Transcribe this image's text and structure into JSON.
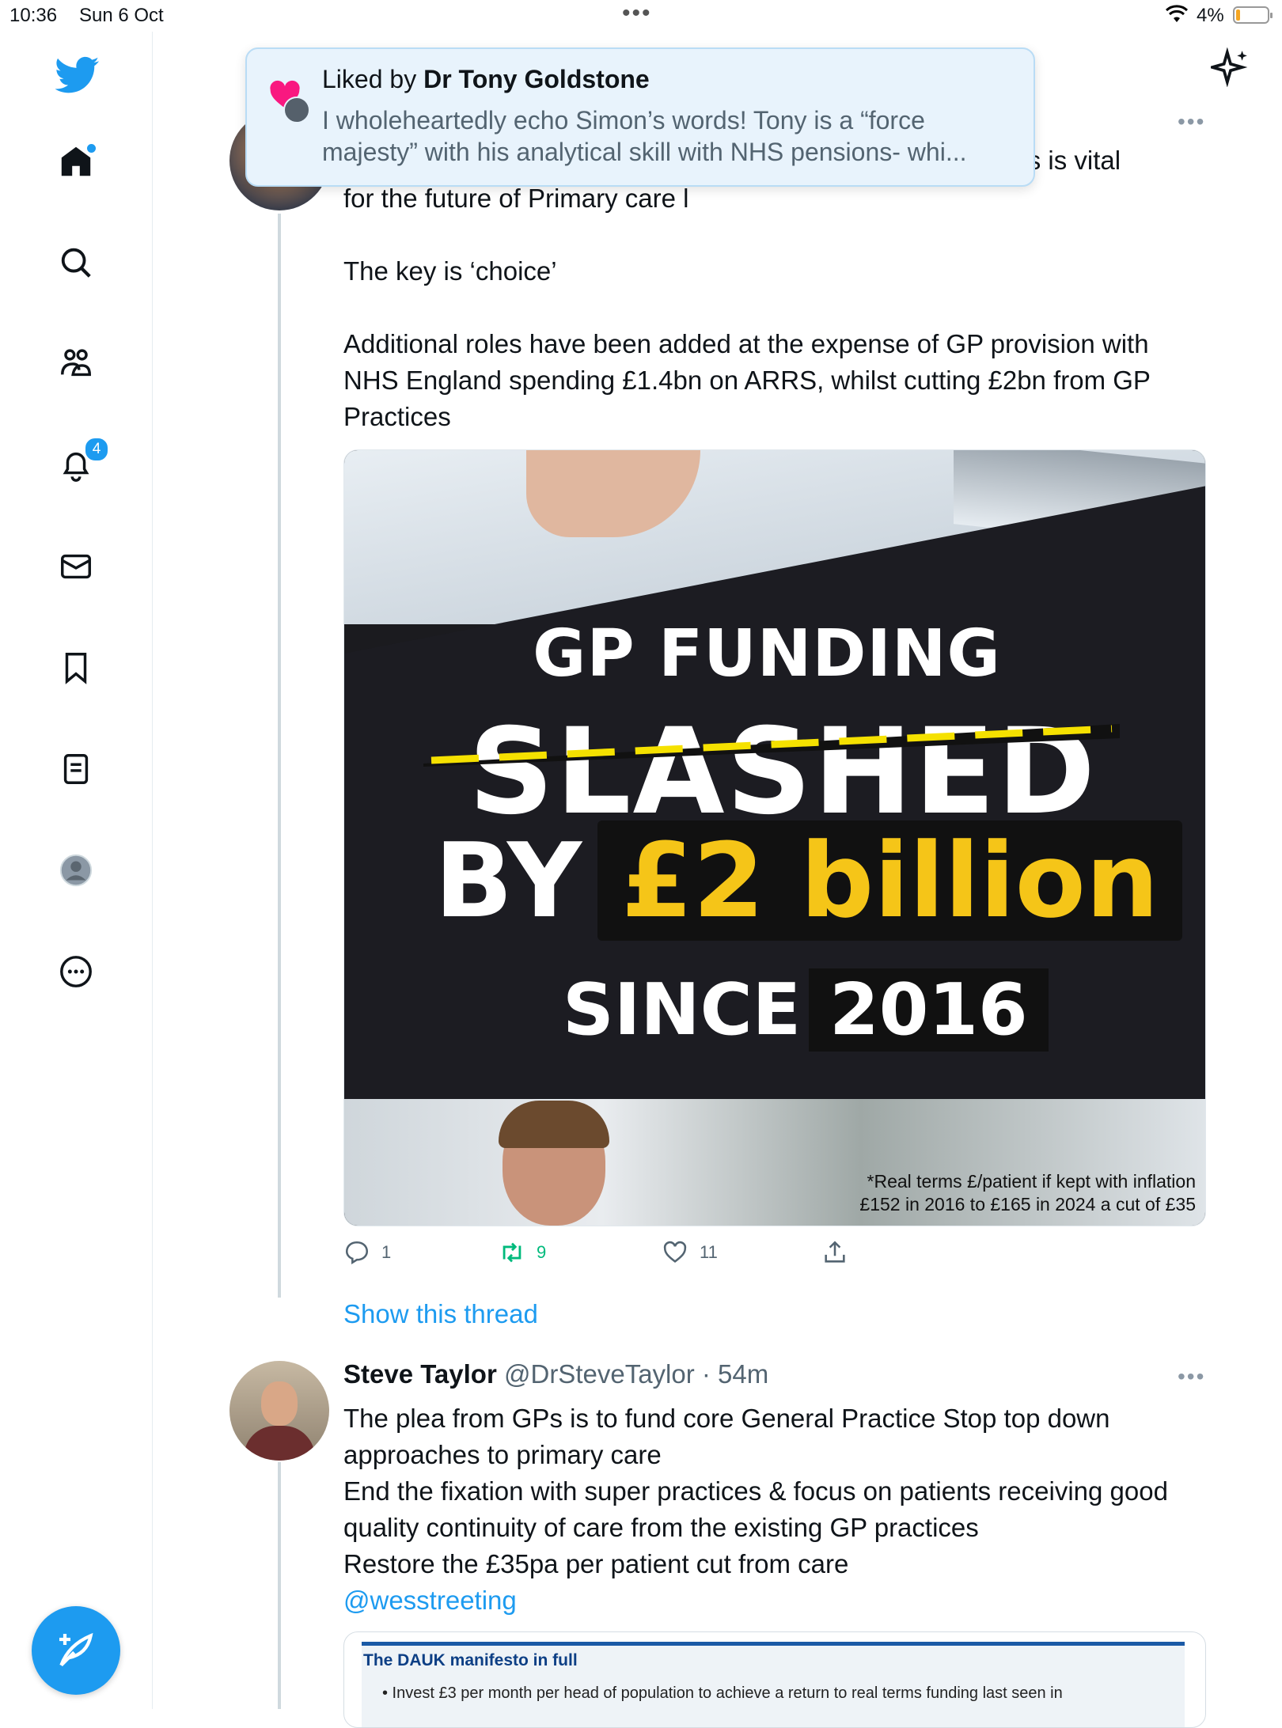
{
  "status_bar": {
    "time": "10:36",
    "date": "Sun 6 Oct",
    "battery": "4%"
  },
  "sidebar": {
    "notification_count": "4"
  },
  "notification_banner": {
    "prefix": "Liked by ",
    "user": "Dr Tony Goldstone",
    "line1": "I wholeheartedly echo Simon’s words! Tony is a “force",
    "line2": "majesty” with his analytical skill with NHS pensions- whi..."
  },
  "tweet1": {
    "partial_line": "atients is vital",
    "line_future": "for the future of Primary care l",
    "line_key": "The key is ‘choice’",
    "para3_line1": "Additional roles have been added at the expense of GP provision with",
    "para3_line2": "NHS England spending £1.4bn on ARRS, whilst cutting £2bn from GP",
    "para3_line3": "Practices",
    "image": {
      "headline1": "GP FUNDING",
      "headline2": "SLASHED",
      "headline3_by": "BY",
      "headline3_amount": "£2 billion",
      "headline4_since": "SINCE",
      "headline4_year": "2016",
      "footnote1": "*Real terms £/patient if kept with inflation",
      "footnote2": "£152 in 2016 to £165 in 2024 a cut of £35"
    },
    "replies": "1",
    "retweets": "9",
    "likes": "11"
  },
  "show_thread": "Show this thread",
  "tweet2": {
    "name": "Steve Taylor",
    "meta": "@DrSteveTaylor · 54m",
    "line1": "The plea from GPs is to fund core General Practice Stop top down",
    "line2": "approaches to primary care",
    "line3": "End the fixation with super practices & focus on patients receiving good",
    "line4": "quality continuity of care from the existing GP practices",
    "line5": "Restore the £35pa per patient cut from care",
    "mention": "@wesstreeting",
    "card_title": "The DAUK manifesto in full",
    "card_bullet": "•  Invest £3 per month per head of population to achieve a return to real terms funding last seen in"
  },
  "colors": {
    "twitter_blue": "#1d9bf0",
    "retweet_green": "#00ba7c",
    "like_pink": "#f91880",
    "slash_yellow": "#f5e100",
    "amount_yellow": "#f5c518"
  }
}
